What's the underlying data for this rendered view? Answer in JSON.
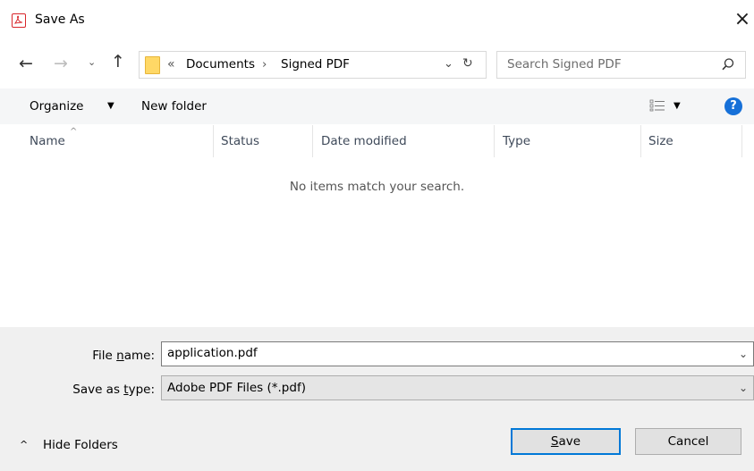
{
  "window": {
    "title": "Save As",
    "close_glyph": "×"
  },
  "nav": {
    "back_glyph": "←",
    "forward_glyph": "→",
    "recent_glyph": "⌄",
    "up_glyph": "↑",
    "breadcrumb_overflow": "«",
    "breadcrumbs": [
      "Documents",
      "Signed PDF"
    ],
    "breadcrumb_sep": "›",
    "dropdown_glyph": "⌄",
    "refresh_glyph": "↻",
    "search_placeholder": "Search Signed PDF"
  },
  "toolbar": {
    "organize_label": "Organize",
    "caret": "▼",
    "new_folder_label": "New folder",
    "help_glyph": "?"
  },
  "columns": {
    "sort_glyph": "^",
    "headers": [
      "Name",
      "Status",
      "Date modified",
      "Type",
      "Size"
    ]
  },
  "list": {
    "empty_message": "No items match your search."
  },
  "form": {
    "file_name_label_pre": "File ",
    "file_name_label_ul": "n",
    "file_name_label_post": "ame:",
    "file_name_value": "application.pdf",
    "save_type_label_pre": "Save as ",
    "save_type_label_ul": "t",
    "save_type_label_post": "ype:",
    "save_type_value": "Adobe PDF Files (*.pdf)",
    "dropdown_glyph": "⌄"
  },
  "footer": {
    "hide_caret": "^",
    "hide_folders_label": "Hide Folders",
    "save_ul": "S",
    "save_rest": "ave",
    "cancel_label": "Cancel"
  },
  "colors": {
    "accent": "#0078d7",
    "app_icon": "#d8262b",
    "folder": "#ffd866",
    "help": "#1670d8"
  }
}
